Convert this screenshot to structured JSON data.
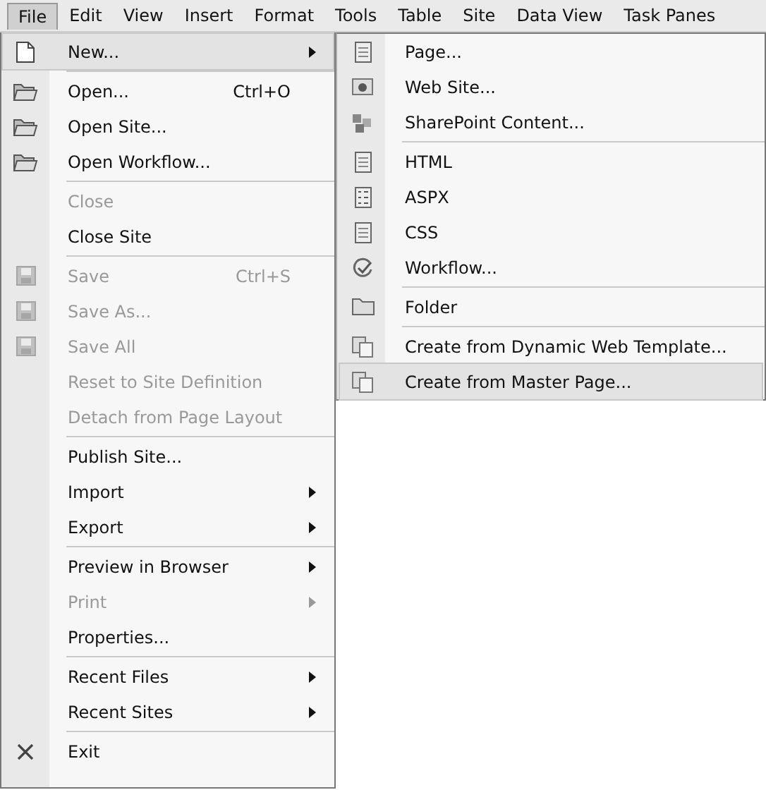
{
  "menubar": [
    {
      "label": "File",
      "selected": true
    },
    {
      "label": "Edit",
      "selected": false
    },
    {
      "label": "View",
      "selected": false
    },
    {
      "label": "Insert",
      "selected": false
    },
    {
      "label": "Format",
      "selected": false
    },
    {
      "label": "Tools",
      "selected": false
    },
    {
      "label": "Table",
      "selected": false
    },
    {
      "label": "Site",
      "selected": false
    },
    {
      "label": "Data View",
      "selected": false
    },
    {
      "label": "Task Panes",
      "selected": false
    }
  ],
  "file_menu": [
    {
      "label": "New...",
      "kind": "submenu",
      "disabled": false,
      "selected": true,
      "separator_after": true
    },
    {
      "label": "Open...",
      "kind": "command",
      "shortcut": "Ctrl+O",
      "disabled": false,
      "selected": false,
      "separator_after": false
    },
    {
      "label": "Open Site...",
      "kind": "command",
      "disabled": false,
      "selected": false,
      "separator_after": false
    },
    {
      "label": "Open Workflow...",
      "kind": "command",
      "disabled": false,
      "selected": false,
      "separator_after": true
    },
    {
      "label": "Close",
      "kind": "command",
      "disabled": true,
      "selected": false,
      "separator_after": false
    },
    {
      "label": "Close Site",
      "kind": "command",
      "disabled": false,
      "selected": false,
      "separator_after": true
    },
    {
      "label": "Save",
      "kind": "command",
      "shortcut": "Ctrl+S",
      "disabled": true,
      "selected": false,
      "separator_after": false
    },
    {
      "label": "Save As...",
      "kind": "command",
      "disabled": true,
      "selected": false,
      "separator_after": false
    },
    {
      "label": "Save All",
      "kind": "command",
      "disabled": true,
      "selected": false,
      "separator_after": false
    },
    {
      "label": "Reset to Site Definition",
      "kind": "command",
      "disabled": true,
      "selected": false,
      "separator_after": false
    },
    {
      "label": "Detach from Page Layout",
      "kind": "command",
      "disabled": true,
      "selected": false,
      "separator_after": true
    },
    {
      "label": "Publish Site...",
      "kind": "command",
      "disabled": false,
      "selected": false,
      "separator_after": false
    },
    {
      "label": "Import",
      "kind": "submenu",
      "disabled": false,
      "selected": false,
      "separator_after": false
    },
    {
      "label": "Export",
      "kind": "submenu",
      "disabled": false,
      "selected": false,
      "separator_after": true
    },
    {
      "label": "Preview in Browser",
      "kind": "submenu",
      "disabled": false,
      "selected": false,
      "separator_after": false
    },
    {
      "label": "Print",
      "kind": "submenu",
      "disabled": true,
      "selected": false,
      "separator_after": false
    },
    {
      "label": "Properties...",
      "kind": "command",
      "disabled": false,
      "selected": false,
      "separator_after": true
    },
    {
      "label": "Recent Files",
      "kind": "submenu",
      "disabled": false,
      "selected": false,
      "separator_after": false
    },
    {
      "label": "Recent Sites",
      "kind": "submenu",
      "disabled": false,
      "selected": false,
      "separator_after": true
    },
    {
      "label": "Exit",
      "kind": "command",
      "disabled": false,
      "selected": false,
      "separator_after": false
    }
  ],
  "new_submenu": [
    {
      "label": "Page...",
      "selected": false,
      "separator_after": false
    },
    {
      "label": "Web Site...",
      "selected": false,
      "separator_after": false
    },
    {
      "label": "SharePoint Content...",
      "selected": false,
      "separator_after": true
    },
    {
      "label": "HTML",
      "selected": false,
      "separator_after": false
    },
    {
      "label": "ASPX",
      "selected": false,
      "separator_after": false
    },
    {
      "label": "CSS",
      "selected": false,
      "separator_after": false
    },
    {
      "label": "Workflow...",
      "selected": false,
      "separator_after": true
    },
    {
      "label": "Folder",
      "selected": false,
      "separator_after": true
    },
    {
      "label": "Create from Dynamic Web Template...",
      "selected": false,
      "separator_after": false
    },
    {
      "label": "Create from Master Page...",
      "selected": true,
      "separator_after": false
    }
  ]
}
